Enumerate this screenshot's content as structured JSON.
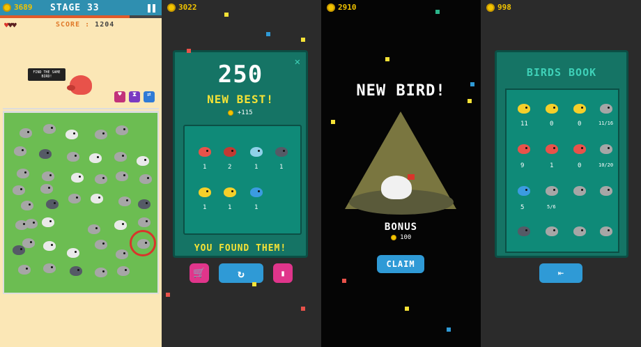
{
  "panel1": {
    "coins": "3689",
    "stage": "STAGE 33",
    "lives_icon": "heart-icon",
    "score_label": "SCORE",
    "score_value": "1204",
    "speech": "FIND THE SAME BIRD!",
    "powerups": [
      "heart-powerup-icon",
      "hourglass-powerup-icon",
      "shuffle-powerup-icon"
    ],
    "colors": {
      "bg": "#fbe7b6",
      "grass": "#6cbd52",
      "topbar": "#2f8fb0",
      "progress": "#e05a2a"
    }
  },
  "panel2": {
    "coins": "3022",
    "score": "250",
    "best_label": "NEW BEST!",
    "coins_gain": "+115",
    "found_counts": [
      "1",
      "2",
      "1",
      "1",
      "1",
      "1",
      "1"
    ],
    "banner": "YOU FOUND THEM!",
    "colors": {
      "card": "#0f8a78",
      "frame": "#157465",
      "accent": "#f5e236"
    }
  },
  "panel3": {
    "coins": "2910",
    "title": "NEW BIRD!",
    "bonus_label": "BONUS",
    "bonus_value": "100",
    "claim_label": "CLAIM"
  },
  "panel4": {
    "coins": "998",
    "title": "BIRDS BOOK",
    "row1": [
      "11",
      "0",
      "0",
      "11/16"
    ],
    "row2": [
      "9",
      "1",
      "0",
      "10/20"
    ],
    "row3": [
      "5",
      "5/6"
    ],
    "back_icon": "back-arrow-icon"
  }
}
